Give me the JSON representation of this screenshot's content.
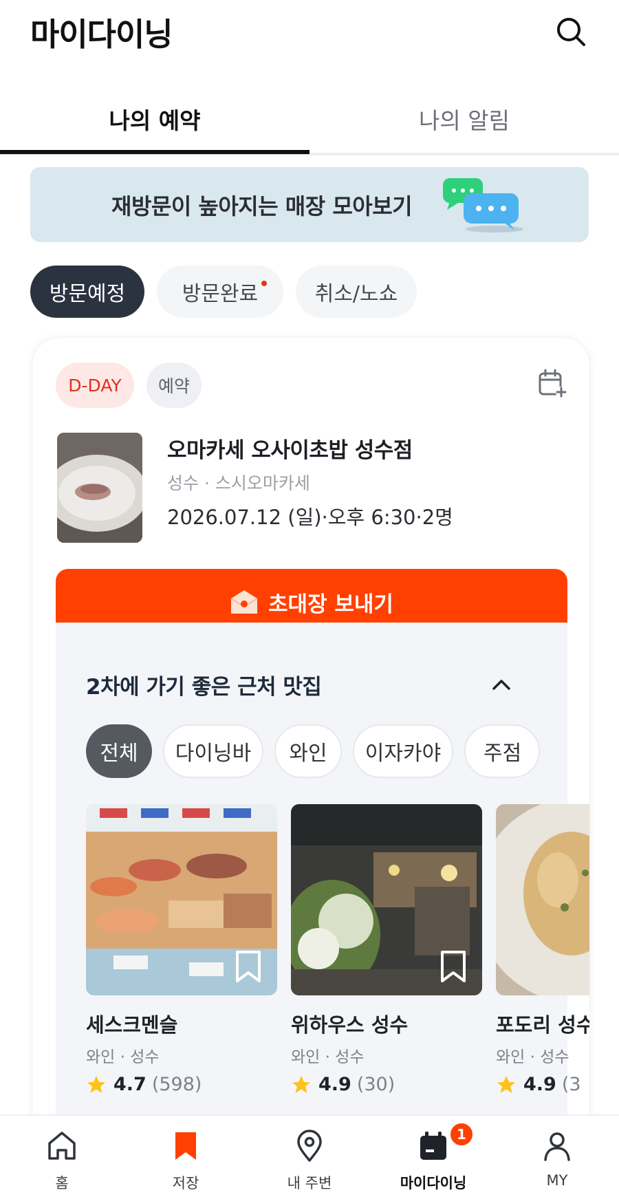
{
  "header": {
    "title": "마이다이닝"
  },
  "tabs": [
    {
      "label": "나의 예약",
      "active": true
    },
    {
      "label": "나의 알림",
      "active": false
    }
  ],
  "banner": {
    "text": "재방문이 높아지는 매장 모아보기"
  },
  "status_chips": [
    {
      "label": "방문예정",
      "active": true
    },
    {
      "label": "방문완료",
      "active": false,
      "dot": true
    },
    {
      "label": "취소/노쇼",
      "active": false
    }
  ],
  "reservation": {
    "dday": "D-DAY",
    "type": "예약",
    "name": "오마카세 오사이초밥 성수점",
    "sub": "성수 · 스시오마카세",
    "datetime": "2026.07.12 (일)·오후 6:30·2명",
    "invite_label": "초대장 보내기"
  },
  "nearby": {
    "title": "2차에 가기 좋은 근처 맛집",
    "filters": [
      "전체",
      "다이닝바",
      "와인",
      "이자카야",
      "주점"
    ],
    "places": [
      {
        "name": "세스크멘슬",
        "category": "와인 · 성수",
        "rating": "4.7",
        "count": "(598)"
      },
      {
        "name": "위하우스 성수",
        "category": "와인 · 성수",
        "rating": "4.9",
        "count": "(30)"
      },
      {
        "name": "포도리 성수",
        "category": "와인 · 성수",
        "rating": "4.9",
        "count": "(3"
      }
    ]
  },
  "bottom_nav": [
    {
      "label": "홈",
      "icon": "home-icon"
    },
    {
      "label": "저장",
      "icon": "bookmark-icon"
    },
    {
      "label": "내 주변",
      "icon": "location-pin-icon"
    },
    {
      "label": "마이다이닝",
      "icon": "calendar-icon",
      "active": true,
      "badge": "1"
    },
    {
      "label": "MY",
      "icon": "person-icon"
    }
  ],
  "colors": {
    "accent": "#ff4000",
    "dark_chip": "#2b3240",
    "banner_bg": "#d9e7ef",
    "dday_text": "#e0301e"
  }
}
